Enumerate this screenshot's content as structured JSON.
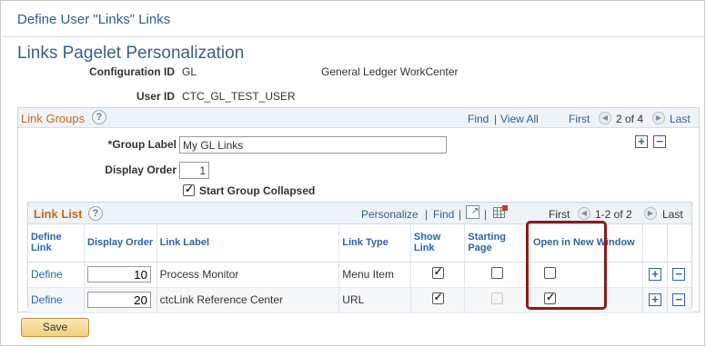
{
  "window": {
    "title": "Define User \"Links\" Links"
  },
  "page": {
    "title": "Links Pagelet Personalization"
  },
  "header": {
    "config_label": "Configuration ID",
    "config_value": "GL",
    "config_desc": "General Ledger WorkCenter",
    "user_label": "User ID",
    "user_value": "CTC_GL_TEST_USER"
  },
  "link_groups": {
    "title": "Link Groups",
    "nav": {
      "find": "Find",
      "view_all": "View All",
      "first": "First",
      "count": "2 of 4",
      "last": "Last"
    },
    "group_label_caption": "*Group Label",
    "group_label_value": "My GL Links",
    "display_order_caption": "Display Order",
    "display_order_value": "1",
    "start_collapsed_label": "Start Group Collapsed",
    "start_collapsed_checked": true
  },
  "link_list": {
    "title": "Link List",
    "nav": {
      "personalize": "Personalize",
      "find": "Find",
      "first": "First",
      "count": "1-2 of 2",
      "last": "Last"
    },
    "columns": {
      "define_link": "Define Link",
      "display_order": "Display Order",
      "link_label": "Link Label",
      "link_type": "Link Type",
      "show_link": "Show Link",
      "starting_page": "Starting Page",
      "open_new_window": "Open in New Window"
    },
    "rows": [
      {
        "define": "Define",
        "order": "10",
        "label": "Process Monitor",
        "type": "Menu Item",
        "show": true,
        "starting": false,
        "new_window": false
      },
      {
        "define": "Define",
        "order": "20",
        "label": "ctcLink Reference Center",
        "type": "URL",
        "show": true,
        "starting": false,
        "new_window": true
      }
    ]
  },
  "buttons": {
    "save": "Save"
  },
  "icons": {
    "help": "help-icon",
    "prev": "prev-arrow-icon",
    "next": "next-arrow-icon",
    "zoom": "new-window-icon",
    "download": "download-grid-icon",
    "add": "add-row-icon",
    "delete": "delete-row-icon"
  },
  "colors": {
    "link": "#2c64a8",
    "section_title": "#c26b1c",
    "highlight": "#8b1c1c",
    "save_button": "#f2cf7e"
  }
}
